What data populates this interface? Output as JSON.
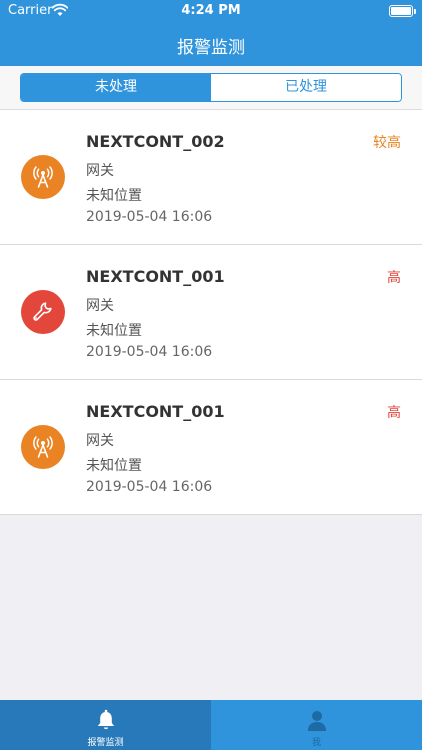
{
  "status_bar": {
    "carrier": "Carrier",
    "time": "4:24 PM",
    "battery_level": 1.0
  },
  "nav": {
    "title": "报警监测"
  },
  "segments": [
    {
      "label": "未处理",
      "selected": true
    },
    {
      "label": "已处理",
      "selected": false
    }
  ],
  "alarms": [
    {
      "name": "NEXTCONT_002",
      "type": "网关",
      "location": "未知位置",
      "date": "2019-05-04 16:06",
      "level": "较高",
      "level_color": "#e8831f",
      "icon": "antenna-icon",
      "icon_color": "#ea8324"
    },
    {
      "name": "NEXTCONT_001",
      "type": "网关",
      "location": "未知位置",
      "date": "2019-05-04 16:06",
      "level": "高",
      "level_color": "#e2463b",
      "icon": "wrench-icon",
      "icon_color": "#e3473b"
    },
    {
      "name": "NEXTCONT_001",
      "type": "网关",
      "location": "未知位置",
      "date": "2019-05-04 16:06",
      "level": "高",
      "level_color": "#e2463b",
      "icon": "antenna-icon",
      "icon_color": "#ea8324"
    }
  ],
  "tabs": [
    {
      "label": "报警监测",
      "icon": "bell-icon",
      "active": true
    },
    {
      "label": "我",
      "icon": "user-icon",
      "active": false
    }
  ],
  "colors": {
    "primary": "#2f94dc",
    "tab_active": "#2779b9"
  }
}
